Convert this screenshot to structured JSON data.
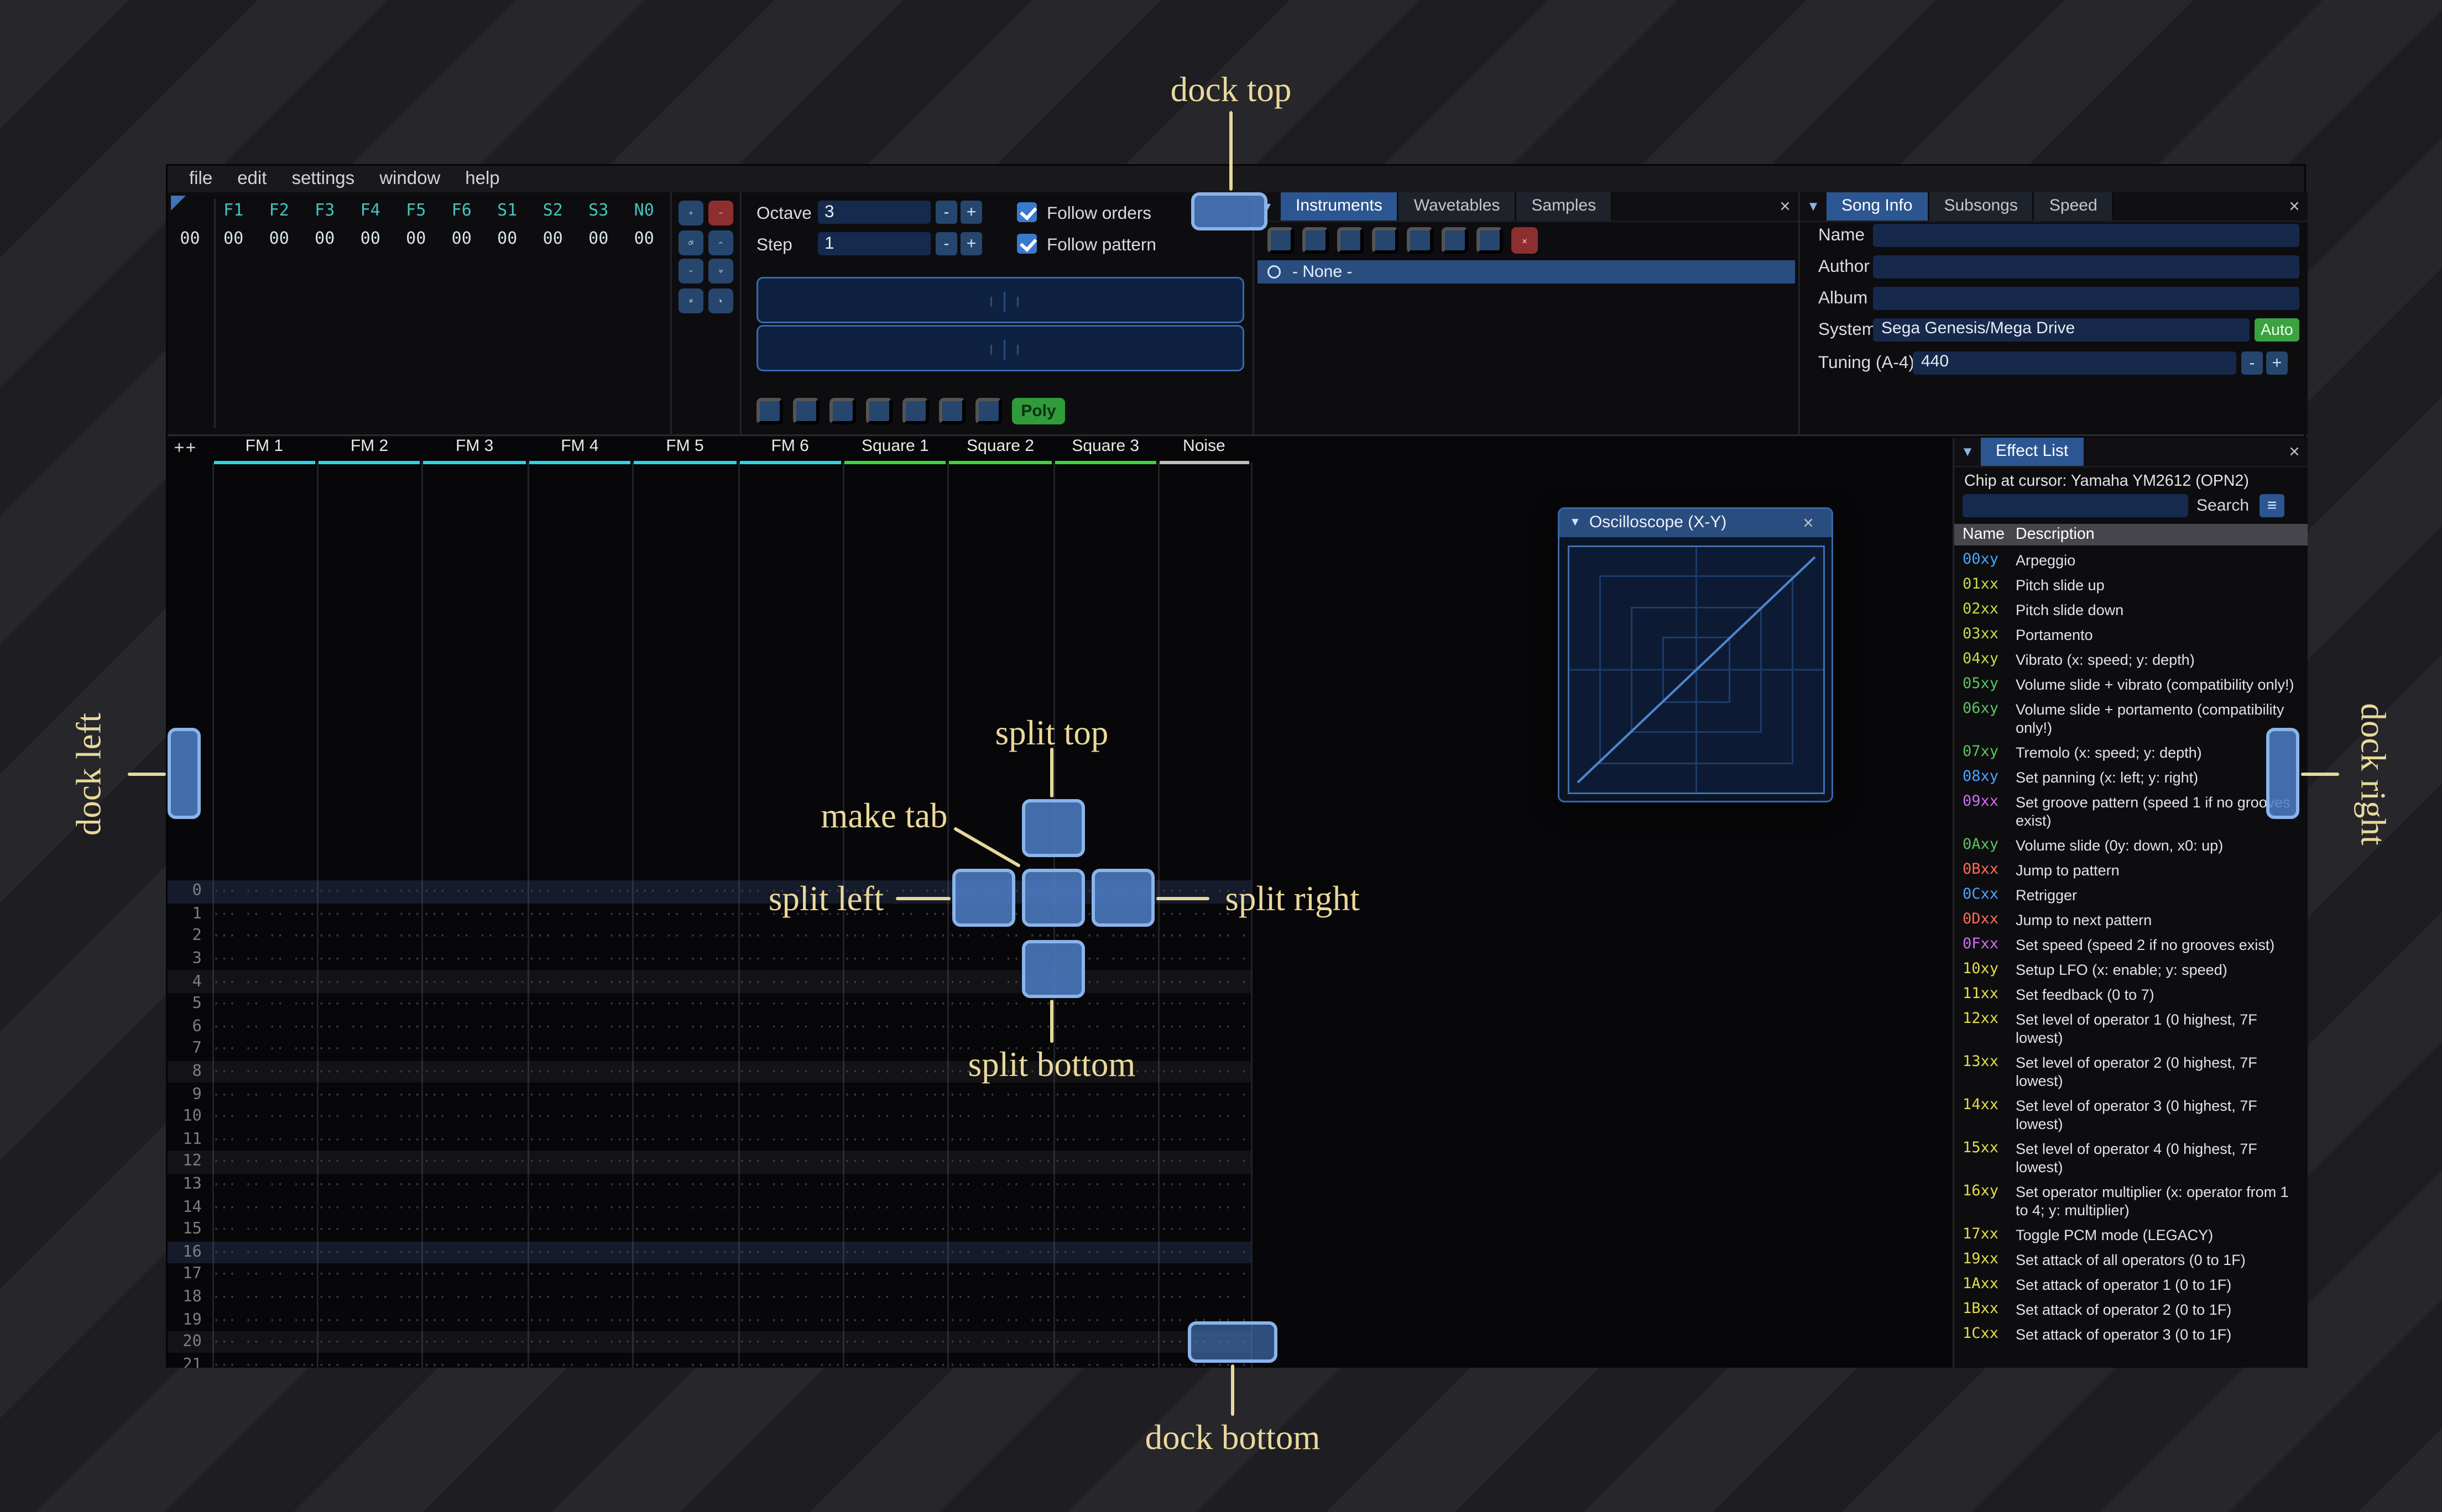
{
  "ui": {
    "close": "×",
    "tab_menu": "▾",
    "collapse": "▼",
    "minus": "-",
    "plus": "+",
    "hamburger": "≡"
  },
  "menu": {
    "items": [
      "file",
      "edit",
      "settings",
      "window",
      "help"
    ]
  },
  "orders": {
    "channel_headers": [
      "F1",
      "F2",
      "F3",
      "F4",
      "F5",
      "F6",
      "S1",
      "S2",
      "S3",
      "N0"
    ],
    "rows": [
      {
        "index": "00",
        "values": [
          "00",
          "00",
          "00",
          "00",
          "00",
          "00",
          "00",
          "00",
          "00",
          "00"
        ]
      }
    ],
    "buttons": [
      {
        "name": "add-order-button",
        "icon": "plus"
      },
      {
        "name": "remove-order-button",
        "icon": "minus",
        "variant": "danger"
      },
      {
        "name": "duplicate-order-button",
        "icon": "copy"
      },
      {
        "name": "move-order-up-button",
        "icon": "chevron-up"
      },
      {
        "name": "move-order-down-button",
        "icon": "chevron-down"
      },
      {
        "name": "duplicate-order-end-button",
        "icon": "chevrons-down"
      },
      {
        "name": "order-change-mode-button",
        "icon": "swap"
      },
      {
        "name": "order-edit-mode-button",
        "icon": "cursor"
      }
    ]
  },
  "controls": {
    "octave_label": "Octave",
    "octave_value": "3",
    "step_label": "Step",
    "step_value": "1",
    "follow_orders_label": "Follow orders",
    "follow_orders_checked": true,
    "follow_pattern_label": "Follow pattern",
    "follow_pattern_checked": true,
    "poly_label": "Poly",
    "transport": [
      {
        "name": "play-button",
        "icon": "play"
      },
      {
        "name": "play-pattern-button",
        "icon": "play-circle"
      },
      {
        "name": "play-once-button",
        "icon": "play-once"
      },
      {
        "name": "step-row-button",
        "icon": "arrow-down"
      },
      {
        "name": "edit-record-button",
        "icon": "record",
        "variant": "record"
      },
      {
        "name": "metronome-button",
        "icon": "metronome"
      },
      {
        "name": "repeat-pattern-button",
        "icon": "repeat"
      }
    ]
  },
  "assets": {
    "tabs": [
      "Instruments",
      "Wavetables",
      "Samples"
    ],
    "active_tab": "Instruments",
    "toolbar": [
      {
        "name": "add-instrument-button",
        "icon": "plus"
      },
      {
        "name": "duplicate-instrument-button",
        "icon": "copy"
      },
      {
        "name": "open-instrument-button",
        "icon": "folder"
      },
      {
        "name": "save-instrument-button",
        "icon": "floppy"
      },
      {
        "name": "instrument-folders-button",
        "icon": "sitemap"
      },
      {
        "name": "move-instrument-up-button",
        "icon": "arrow-up"
      },
      {
        "name": "move-instrument-down-button",
        "icon": "arrow-down"
      },
      {
        "name": "delete-instrument-button",
        "icon": "close",
        "variant": "danger"
      }
    ],
    "selected_item": "- None -"
  },
  "song_info": {
    "tabs": [
      "Song Info",
      "Subsongs",
      "Speed"
    ],
    "active_tab": "Song Info",
    "name_label": "Name",
    "name_value": "",
    "author_label": "Author",
    "author_value": "",
    "album_label": "Album",
    "album_value": "",
    "system_label": "System",
    "system_value": "Sega Genesis/Mega Drive",
    "auto_label": "Auto",
    "tuning_label": "Tuning (A-4)",
    "tuning_value": "440"
  },
  "pattern": {
    "corner": "++",
    "channels": [
      {
        "name": "FM 1",
        "type": "fm"
      },
      {
        "name": "FM 2",
        "type": "fm"
      },
      {
        "name": "FM 3",
        "type": "fm"
      },
      {
        "name": "FM 4",
        "type": "fm"
      },
      {
        "name": "FM 5",
        "type": "fm"
      },
      {
        "name": "FM 6",
        "type": "fm"
      },
      {
        "name": "Square 1",
        "type": "square"
      },
      {
        "name": "Square 2",
        "type": "square"
      },
      {
        "name": "Square 3",
        "type": "square"
      },
      {
        "name": "Noise",
        "type": "noise"
      }
    ],
    "channel_colors": {
      "fm": "#2ed3e2",
      "square": "#3bd63b",
      "noise": "#bdbdbd"
    },
    "row_start": 0,
    "visible_rows": 22,
    "empty_cell": "··· ·· ·· ···",
    "highlight_every": 4,
    "highlight2_every": 16
  },
  "oscilloscope": {
    "title": "Oscilloscope (X-Y)"
  },
  "effect_list": {
    "tab": "Effect List",
    "chip_line": "Chip at cursor: Yamaha YM2612 (OPN2)",
    "search_value": "",
    "search_label": "Search",
    "columns": [
      "Name",
      "Description"
    ],
    "colors": {
      "misc": "#4aa3ff",
      "pitch": "#c9da43",
      "volume": "#57c55a",
      "groove": "#cf6bf0",
      "jump": "#ff6b54",
      "chip": "#e3dd4b"
    },
    "effects": [
      {
        "code": "00xy",
        "cat": "misc",
        "desc": "Arpeggio"
      },
      {
        "code": "01xx",
        "cat": "pitch",
        "desc": "Pitch slide up"
      },
      {
        "code": "02xx",
        "cat": "pitch",
        "desc": "Pitch slide down"
      },
      {
        "code": "03xx",
        "cat": "pitch",
        "desc": "Portamento"
      },
      {
        "code": "04xy",
        "cat": "pitch",
        "desc": "Vibrato (x: speed; y: depth)"
      },
      {
        "code": "05xy",
        "cat": "volume",
        "desc": "Volume slide + vibrato (compatibility only!)"
      },
      {
        "code": "06xy",
        "cat": "volume",
        "desc": "Volume slide + portamento (compatibility only!)"
      },
      {
        "code": "07xy",
        "cat": "volume",
        "desc": "Tremolo (x: speed; y: depth)"
      },
      {
        "code": "08xy",
        "cat": "misc",
        "desc": "Set panning (x: left; y: right)"
      },
      {
        "code": "09xx",
        "cat": "groove",
        "desc": "Set groove pattern (speed 1 if no grooves exist)"
      },
      {
        "code": "0Axy",
        "cat": "volume",
        "desc": "Volume slide (0y: down, x0: up)"
      },
      {
        "code": "0Bxx",
        "cat": "jump",
        "desc": "Jump to pattern"
      },
      {
        "code": "0Cxx",
        "cat": "misc",
        "desc": "Retrigger"
      },
      {
        "code": "0Dxx",
        "cat": "jump",
        "desc": "Jump to next pattern"
      },
      {
        "code": "0Fxx",
        "cat": "groove",
        "desc": "Set speed (speed 2 if no grooves exist)"
      },
      {
        "code": "10xy",
        "cat": "chip",
        "desc": "Setup LFO (x: enable; y: speed)"
      },
      {
        "code": "11xx",
        "cat": "chip",
        "desc": "Set feedback (0 to 7)"
      },
      {
        "code": "12xx",
        "cat": "chip",
        "desc": "Set level of operator 1 (0 highest, 7F lowest)"
      },
      {
        "code": "13xx",
        "cat": "chip",
        "desc": "Set level of operator 2 (0 highest, 7F lowest)"
      },
      {
        "code": "14xx",
        "cat": "chip",
        "desc": "Set level of operator 3 (0 highest, 7F lowest)"
      },
      {
        "code": "15xx",
        "cat": "chip",
        "desc": "Set level of operator 4 (0 highest, 7F lowest)"
      },
      {
        "code": "16xy",
        "cat": "chip",
        "desc": "Set operator multiplier (x: operator from 1 to 4; y: multiplier)"
      },
      {
        "code": "17xx",
        "cat": "chip",
        "desc": "Toggle PCM mode (LEGACY)"
      },
      {
        "code": "19xx",
        "cat": "chip",
        "desc": "Set attack of all operators (0 to 1F)"
      },
      {
        "code": "1Axx",
        "cat": "chip",
        "desc": "Set attack of operator 1 (0 to 1F)"
      },
      {
        "code": "1Bxx",
        "cat": "chip",
        "desc": "Set attack of operator 2 (0 to 1F)"
      },
      {
        "code": "1Cxx",
        "cat": "chip",
        "desc": "Set attack of operator 3 (0 to 1F)"
      }
    ]
  },
  "overlay": {
    "dock_top": "dock top",
    "dock_bottom": "dock bottom",
    "dock_left": "dock left",
    "dock_right": "dock right",
    "split_top": "split top",
    "split_bottom": "split bottom",
    "split_left": "split left",
    "split_right": "split right",
    "make_tab": "make tab",
    "label_color": "#ead99b",
    "target_color": "#4d7ec8"
  },
  "colors": {
    "accent": "#3a79cc",
    "active_tab": "#2b5691",
    "auto_green": "#3aa33f",
    "poly_green": "#2f9b3a"
  }
}
